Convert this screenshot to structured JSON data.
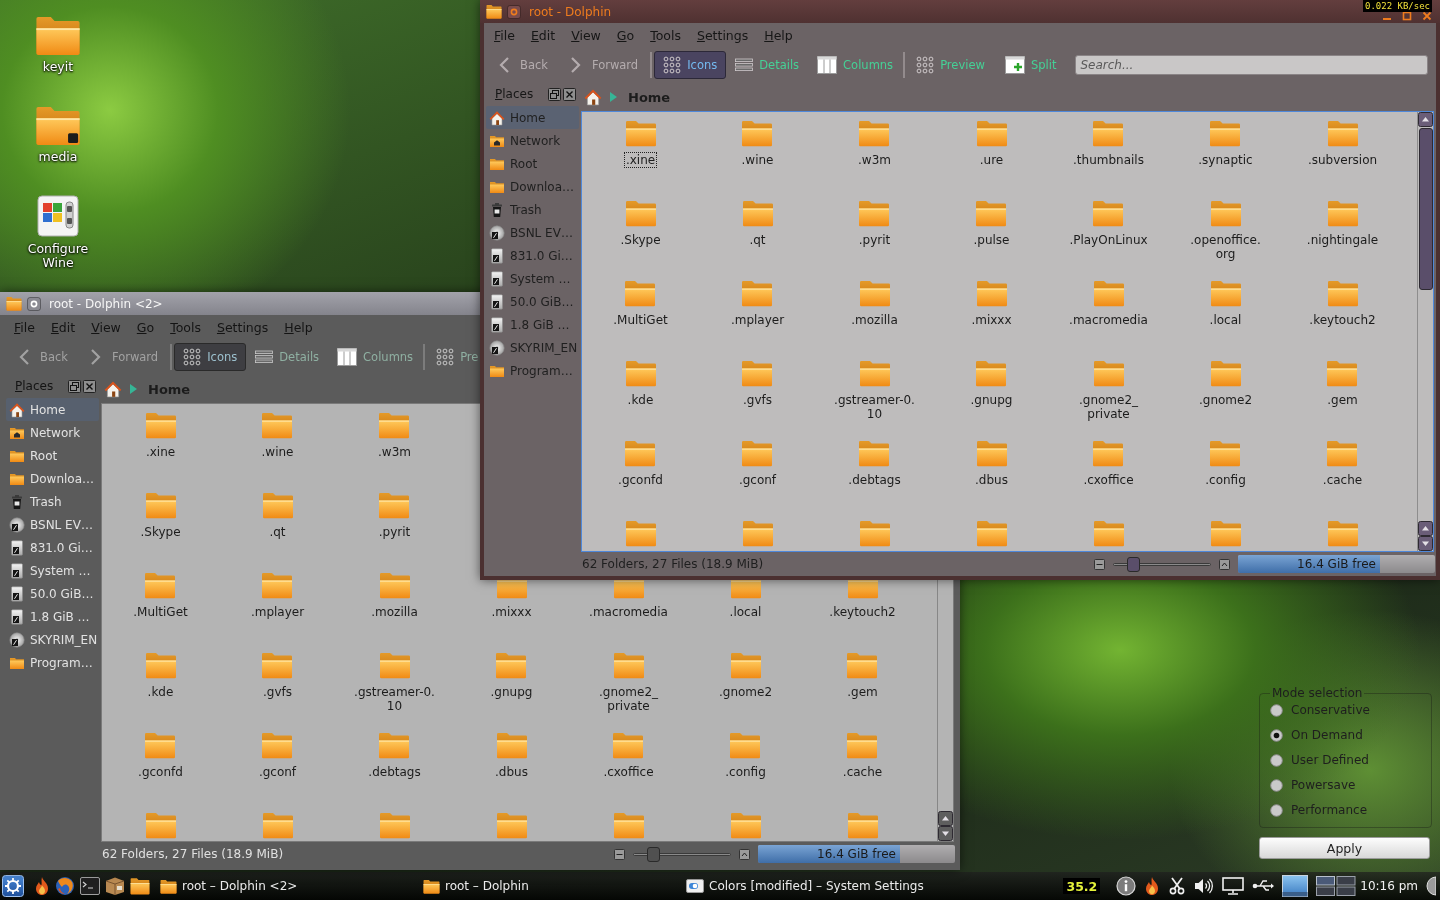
{
  "desktop_icons": [
    {
      "label": "keyit",
      "kind": "folder"
    },
    {
      "label": "media",
      "kind": "mount"
    },
    {
      "label": "Configure Wine",
      "kind": "wine"
    }
  ],
  "windows": [
    {
      "title": "root - Dolphin <2>",
      "active": false,
      "menu": [
        "File",
        "Edit",
        "View",
        "Go",
        "Tools",
        "Settings",
        "Help"
      ],
      "navigation": [
        {
          "label": "Back",
          "kind": "back",
          "disabled": true
        },
        {
          "label": "Forward",
          "kind": "forward",
          "disabled": true
        }
      ],
      "view_modes": [
        {
          "label": "Icons",
          "kind": "icons",
          "selected": true
        },
        {
          "label": "Details",
          "kind": "details",
          "selected": false
        },
        {
          "label": "Columns",
          "kind": "columns",
          "selected": false
        }
      ],
      "panels": [
        {
          "label": "Pre",
          "kind": "preview"
        }
      ],
      "places": {
        "title": "Places",
        "items": [
          {
            "label": "Home",
            "kind": "home",
            "selected": true
          },
          {
            "label": "Network",
            "kind": "network",
            "selected": false
          },
          {
            "label": "Root",
            "kind": "folder",
            "selected": false
          },
          {
            "label": "Downloa…",
            "kind": "folder",
            "selected": false
          },
          {
            "label": "Trash",
            "kind": "trash",
            "selected": false
          },
          {
            "label": "BSNL EV…",
            "kind": "optical",
            "selected": false
          },
          {
            "label": "831.0 Gi…",
            "kind": "drive",
            "selected": false
          },
          {
            "label": "System …",
            "kind": "drive",
            "selected": false
          },
          {
            "label": "50.0 GiB…",
            "kind": "drive",
            "selected": false
          },
          {
            "label": "1.8 GiB …",
            "kind": "drive",
            "selected": false
          },
          {
            "label": "SKYRIM_EN",
            "kind": "optical",
            "selected": false
          },
          {
            "label": "Program…",
            "kind": "folder",
            "selected": false
          }
        ]
      },
      "location": "Home",
      "rows": [
        [
          {
            "name": ".xine",
            "focused": false
          },
          {
            "name": ".wine",
            "focused": false
          },
          {
            "name": ".w3m",
            "focused": false
          }
        ],
        [
          {
            "name": ".Skype",
            "focused": false
          },
          {
            "name": ".qt",
            "focused": false
          },
          {
            "name": ".pyrit",
            "focused": false
          }
        ],
        [
          {
            "name": ".MultiGet",
            "focused": false
          },
          {
            "name": ".mplayer",
            "focused": false
          },
          {
            "name": ".mozilla",
            "focused": false
          },
          {
            "name": ".mixxx",
            "focused": false
          },
          {
            "name": ".macromedia",
            "focused": false
          },
          {
            "name": ".local",
            "focused": false
          },
          {
            "name": ".keytouch2",
            "focused": false
          }
        ],
        [
          {
            "name": ".kde",
            "focused": false
          },
          {
            "name": ".gvfs",
            "focused": false
          },
          {
            "name": ".gstreamer-0.\n10",
            "focused": false
          },
          {
            "name": ".gnupg",
            "focused": false
          },
          {
            "name": ".gnome2_\nprivate",
            "focused": false
          },
          {
            "name": ".gnome2",
            "focused": false
          },
          {
            "name": ".gem",
            "focused": false
          }
        ],
        [
          {
            "name": ".gconfd",
            "focused": false
          },
          {
            "name": ".gconf",
            "focused": false
          },
          {
            "name": ".debtags",
            "focused": false
          },
          {
            "name": ".dbus",
            "focused": false
          },
          {
            "name": ".cxoffice",
            "focused": false
          },
          {
            "name": ".config",
            "focused": false
          },
          {
            "name": ".cache",
            "focused": false
          }
        ],
        [
          {
            "focused": false
          },
          {
            "focused": false
          },
          {
            "focused": false
          },
          {
            "focused": false
          },
          {
            "focused": false
          },
          {
            "focused": false
          },
          {
            "focused": false
          }
        ]
      ],
      "status": {
        "summary": "62 Folders, 27 Files (18.9 MiB)",
        "zoom": {
          "level": 0.16
        },
        "free_space": {
          "label": "16.4 GiB free",
          "level": 0.72
        }
      }
    },
    {
      "title": "root - Dolphin",
      "active": true,
      "menu": [
        "File",
        "Edit",
        "View",
        "Go",
        "Tools",
        "Settings",
        "Help"
      ],
      "navigation": [
        {
          "label": "Back",
          "kind": "back",
          "disabled": true
        },
        {
          "label": "Forward",
          "kind": "forward",
          "disabled": true
        }
      ],
      "view_modes": [
        {
          "label": "Icons",
          "kind": "icons",
          "selected": true
        },
        {
          "label": "Details",
          "kind": "details",
          "selected": false
        },
        {
          "label": "Columns",
          "kind": "columns",
          "selected": false
        }
      ],
      "panels": [
        {
          "label": "Preview",
          "kind": "preview"
        },
        {
          "label": "Split",
          "kind": "split"
        }
      ],
      "search": {
        "placeholder": "Search..."
      },
      "places": {
        "title": "Places",
        "items": [
          {
            "label": "Home",
            "kind": "home",
            "selected": true
          },
          {
            "label": "Network",
            "kind": "network",
            "selected": false
          },
          {
            "label": "Root",
            "kind": "folder",
            "selected": false
          },
          {
            "label": "Downloa…",
            "kind": "folder",
            "selected": false
          },
          {
            "label": "Trash",
            "kind": "trash",
            "selected": false
          },
          {
            "label": "BSNL EV…",
            "kind": "optical",
            "selected": false
          },
          {
            "label": "831.0 Gi…",
            "kind": "drive",
            "selected": false
          },
          {
            "label": "System …",
            "kind": "drive",
            "selected": false
          },
          {
            "label": "50.0 GiB…",
            "kind": "drive",
            "selected": false
          },
          {
            "label": "1.8 GiB …",
            "kind": "drive",
            "selected": false
          },
          {
            "label": "SKYRIM_EN",
            "kind": "optical",
            "selected": false
          },
          {
            "label": "Program…",
            "kind": "folder",
            "selected": false
          }
        ]
      },
      "location": "Home",
      "rows": [
        [
          {
            "name": ".xine",
            "focused": true
          },
          {
            "name": ".wine",
            "focused": false
          },
          {
            "name": ".w3m",
            "focused": false
          },
          {
            "name": ".ure",
            "focused": false
          },
          {
            "name": ".thumbnails",
            "focused": false
          },
          {
            "name": ".synaptic",
            "focused": false
          },
          {
            "name": ".subversion",
            "focused": false
          }
        ],
        [
          {
            "name": ".Skype",
            "focused": false
          },
          {
            "name": ".qt",
            "focused": false
          },
          {
            "name": ".pyrit",
            "focused": false
          },
          {
            "name": ".pulse",
            "focused": false
          },
          {
            "name": ".PlayOnLinux",
            "focused": false
          },
          {
            "name": ".openoffice.\norg",
            "focused": false
          },
          {
            "name": ".nightingale",
            "focused": false
          }
        ],
        [
          {
            "name": ".MultiGet",
            "focused": false
          },
          {
            "name": ".mplayer",
            "focused": false
          },
          {
            "name": ".mozilla",
            "focused": false
          },
          {
            "name": ".mixxx",
            "focused": false
          },
          {
            "name": ".macromedia",
            "focused": false
          },
          {
            "name": ".local",
            "focused": false
          },
          {
            "name": ".keytouch2",
            "focused": false
          }
        ],
        [
          {
            "name": ".kde",
            "focused": false
          },
          {
            "name": ".gvfs",
            "focused": false
          },
          {
            "name": ".gstreamer-0.\n10",
            "focused": false
          },
          {
            "name": ".gnupg",
            "focused": false
          },
          {
            "name": ".gnome2_\nprivate",
            "focused": false
          },
          {
            "name": ".gnome2",
            "focused": false
          },
          {
            "name": ".gem",
            "focused": false
          }
        ],
        [
          {
            "name": ".gconfd",
            "focused": false
          },
          {
            "name": ".gconf",
            "focused": false
          },
          {
            "name": ".debtags",
            "focused": false
          },
          {
            "name": ".dbus",
            "focused": false
          },
          {
            "name": ".cxoffice",
            "focused": false
          },
          {
            "name": ".config",
            "focused": false
          },
          {
            "name": ".cache",
            "focused": false
          }
        ],
        [
          {
            "focused": false
          },
          {
            "focused": false
          },
          {
            "focused": false
          },
          {
            "focused": false
          },
          {
            "focused": false
          },
          {
            "focused": false
          },
          {
            "focused": false
          }
        ]
      ],
      "status": {
        "summary": "62 Folders, 27 Files (18.9 MiB)",
        "zoom": {
          "level": 0.16
        },
        "free_space": {
          "label": "16.4 GiB free",
          "level": 0.72
        }
      }
    }
  ],
  "mode_selection": {
    "title": "Mode selection",
    "options": [
      {
        "label": "Conservative",
        "selected": false
      },
      {
        "label": "On Demand",
        "selected": true
      },
      {
        "label": "User Defined",
        "selected": false
      },
      {
        "label": "Powersave",
        "selected": false
      },
      {
        "label": "Performance",
        "selected": false
      }
    ],
    "button": "Apply"
  },
  "network_monitor": "0.022 KB/sec",
  "taskbar": {
    "tasks": [
      {
        "title": "root – Dolphin <2>",
        "kind": "folder"
      },
      {
        "title": "root – Dolphin",
        "kind": "folder"
      },
      {
        "title": "Colors [modified] – System Settings",
        "kind": "settings"
      }
    ],
    "temperature": "35.2",
    "clock": "10:16 pm"
  }
}
